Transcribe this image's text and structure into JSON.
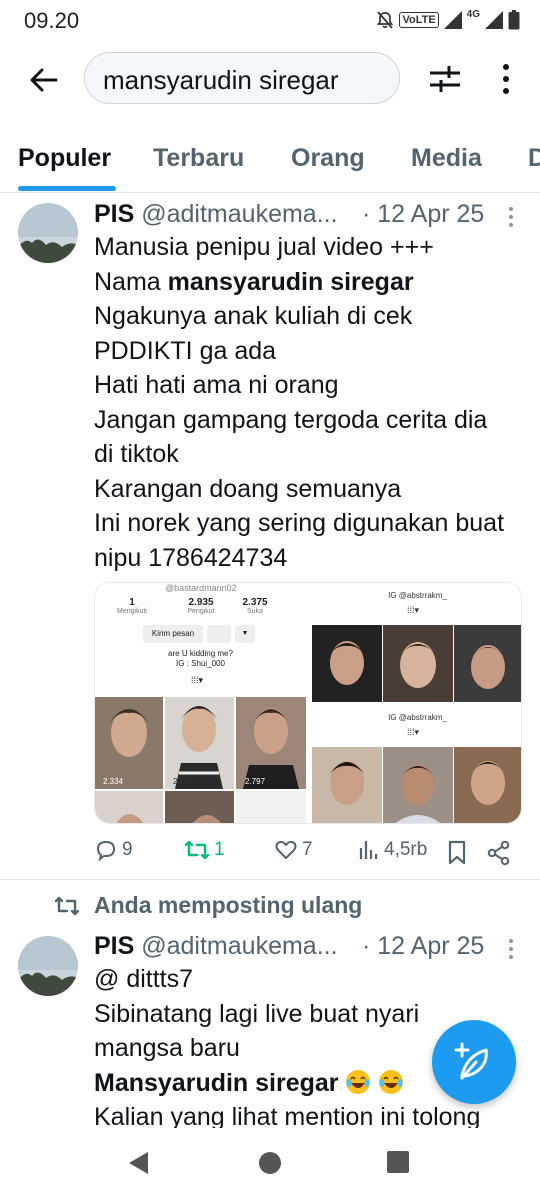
{
  "status_bar": {
    "time": "09.20",
    "volte": "VoLTE",
    "network": "4G"
  },
  "search": {
    "query": "mansyarudin siregar"
  },
  "tabs": [
    "Populer",
    "Terbaru",
    "Orang",
    "Media",
    "D"
  ],
  "tweets": [
    {
      "name": "PIS",
      "handle": "@aditmaukema...",
      "date": "· 12 Apr 25",
      "lines": {
        "l1": "Manusia penipu jual video +++",
        "l2_pre": "Nama ",
        "l2_bold": "mansyarudin siregar",
        "l3": "Ngakunya anak kuliah di cek",
        "l4": "PDDIKTI ga ada",
        "l5": "Hati hati ama ni orang",
        "l6": "Jangan gampang tergoda cerita dia",
        "l7": "di tiktok",
        "l8": "Karangan doang semuanya",
        "l9": "Ini norek yang sering digunakan buat",
        "l10": "nipu 1786424734"
      },
      "media_left": {
        "username": "@bastardmann02",
        "stats": [
          {
            "value": "1",
            "label": "Mengikuti"
          },
          {
            "value": "2.935",
            "label": "Pengikut"
          },
          {
            "value": "2.375",
            "label": "Suka"
          }
        ],
        "message_btn": "Kirim pesan",
        "bio_line1": "are U kidding me?",
        "bio_line2": "IG : Shui_000",
        "views": [
          "2.334",
          "2.244",
          "2.797"
        ]
      },
      "media_right": {
        "top_handle": "IG @abstrrakm_",
        "bottom_handle": "IG @abstrrakm_"
      },
      "actions": {
        "replies": "9",
        "reposts": "1",
        "likes": "7",
        "views": "4,5rb"
      }
    },
    {
      "repost_note": "Anda memposting ulang",
      "name": "PIS",
      "handle": "@aditmaukema...",
      "date": "· 12 Apr 25",
      "lines": {
        "l1": "@ dittts7",
        "l2": "Sibinatang lagi live buat nyari",
        "l3": "mangsa baru",
        "l4_bold": "Mansyarudin siregar",
        "l5": "Kalian yang lihat mention ini tolong"
      }
    }
  ],
  "colors": {
    "accent": "#1d9bf0",
    "repost_green": "#00ba7c",
    "secondary_text": "#536471"
  }
}
